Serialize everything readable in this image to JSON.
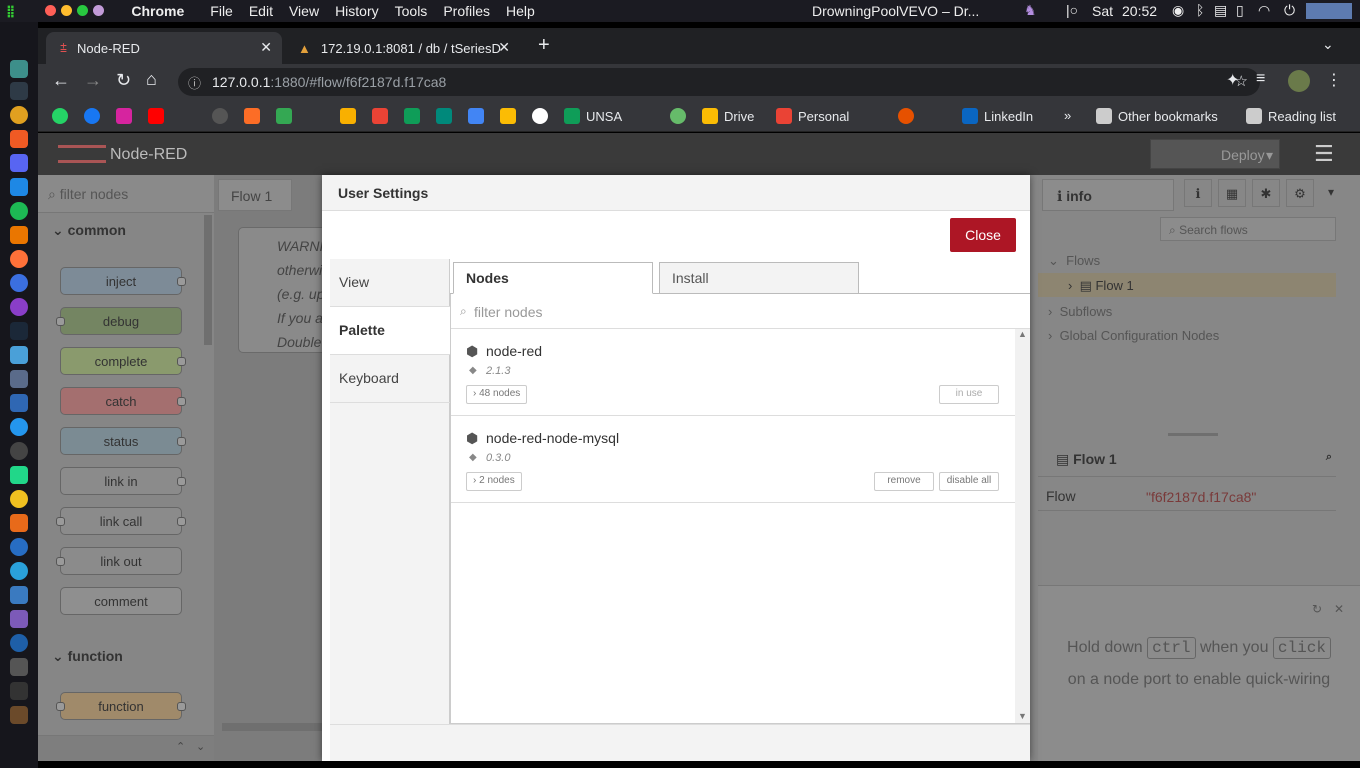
{
  "menubar": {
    "app": "Chrome",
    "items": [
      "File",
      "Edit",
      "View",
      "History",
      "Tools",
      "Profiles",
      "Help"
    ],
    "now_playing": "DrowningPoolVEVO – Dr...",
    "day": "Sat",
    "time": "20:52"
  },
  "browser": {
    "tabs": [
      {
        "title": "Node-RED"
      },
      {
        "title": "172.19.0.1:8081 / db / tSeriesD"
      }
    ],
    "url_host": "127.0.0.1",
    "url_rest": ":1880/#flow/f6f2187d.f17ca8",
    "bookmarks": {
      "unsa": "UNSA",
      "drive": "Drive",
      "personal": "Personal",
      "linkedin": "LinkedIn",
      "other": "Other bookmarks",
      "reading": "Reading list"
    }
  },
  "nodered": {
    "title": "Node-RED",
    "deploy": "Deploy",
    "palette": {
      "filter_placeholder": "filter nodes",
      "cat_common": "common",
      "cat_function": "function",
      "nodes": {
        "inject": "inject",
        "debug": "debug",
        "complete": "complete",
        "catch": "catch",
        "status": "status",
        "link_in": "link in",
        "link_call": "link call",
        "link_out": "link out",
        "comment": "comment",
        "function": "function"
      }
    },
    "workspace_tab": "Flow 1",
    "canvas_comment": [
      "WARNI",
      "otherwi",
      "(e.g. up",
      "If you a",
      "Double"
    ],
    "sidebar": {
      "tab": "info",
      "search_placeholder": "Search flows",
      "tree": {
        "flows": "Flows",
        "flow1": "Flow 1",
        "subflows": "Subflows",
        "global": "Global Configuration Nodes"
      },
      "details_title": "Flow 1",
      "prop_label": "Flow",
      "prop_value": "\"f6f2187d.f17ca8\"",
      "tip_a": "Hold down",
      "tip_key1": "ctrl",
      "tip_b": "when you",
      "tip_key2": "click",
      "tip_c": "on a node port to enable quick-wiring"
    }
  },
  "dialog": {
    "title": "User Settings",
    "close": "Close",
    "sections": {
      "view": "View",
      "palette": "Palette",
      "keyboard": "Keyboard"
    },
    "tabs": {
      "nodes": "Nodes",
      "install": "Install"
    },
    "filter_placeholder": "filter nodes",
    "modules": [
      {
        "name": "node-red",
        "version": "2.1.3",
        "count": "48 nodes",
        "action": "in use"
      },
      {
        "name": "node-red-node-mysql",
        "version": "0.3.0",
        "count": "2 nodes",
        "remove": "remove",
        "disable": "disable all"
      }
    ]
  }
}
